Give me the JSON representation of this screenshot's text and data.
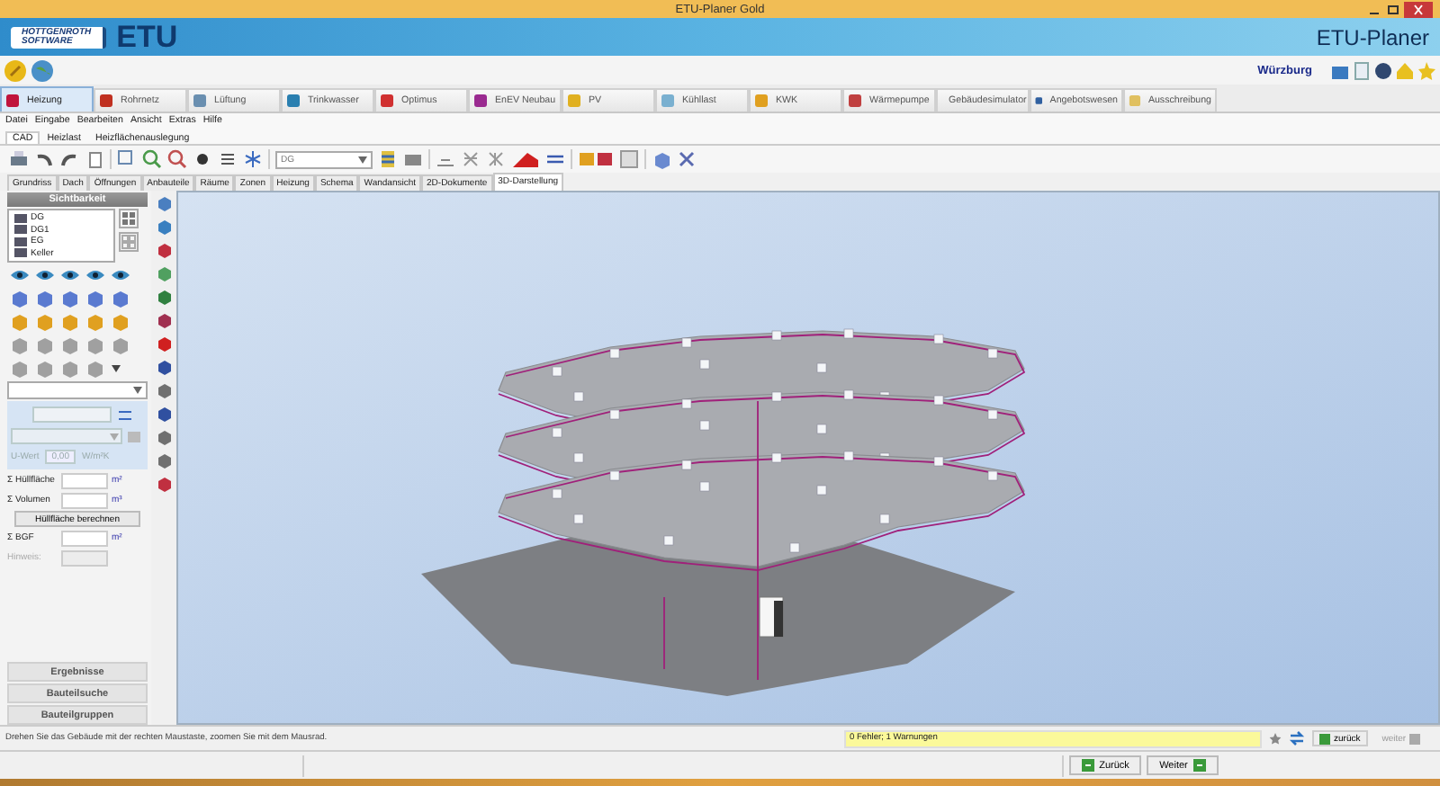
{
  "window": {
    "title": "ETU-Planer Gold"
  },
  "banner": {
    "company_line_1": "HOTTGENROTH",
    "company_line_2": "SOFTWARE",
    "logo": "ETU",
    "product": "ETU-Planer"
  },
  "location": "Würzburg",
  "module_tabs": [
    {
      "label": "Heizung",
      "selected": true
    },
    {
      "label": "Rohrnetz",
      "selected": false
    },
    {
      "label": "Lüftung",
      "selected": false
    },
    {
      "label": "Trinkwasser",
      "selected": false
    },
    {
      "label": "Optimus",
      "selected": false
    },
    {
      "label": "EnEV Neubau",
      "selected": false
    },
    {
      "label": "PV",
      "selected": false
    },
    {
      "label": "Kühllast",
      "selected": false
    },
    {
      "label": "KWK",
      "selected": false
    },
    {
      "label": "Wärmepumpe",
      "selected": false
    },
    {
      "label": "Gebäudesimulator",
      "selected": false
    },
    {
      "label": "Angebotswesen",
      "selected": false
    },
    {
      "label": "Ausschreibung",
      "selected": false
    }
  ],
  "menu": [
    "Datei",
    "Eingabe",
    "Bearbeiten",
    "Ansicht",
    "Extras",
    "Hilfe"
  ],
  "sub_tabs": [
    {
      "label": "CAD",
      "selected": true
    },
    {
      "label": "Heizlast",
      "selected": false
    },
    {
      "label": "Heizflächenauslegung",
      "selected": false
    }
  ],
  "toolbar": {
    "floor_select": "DG"
  },
  "view_tabs": [
    {
      "label": "Grundriss",
      "selected": false
    },
    {
      "label": "Dach",
      "selected": false
    },
    {
      "label": "Öffnungen",
      "selected": false
    },
    {
      "label": "Anbauteile",
      "selected": false
    },
    {
      "label": "Räume",
      "selected": false
    },
    {
      "label": "Zonen",
      "selected": false
    },
    {
      "label": "Heizung",
      "selected": false
    },
    {
      "label": "Schema",
      "selected": false
    },
    {
      "label": "Wandansicht",
      "selected": false
    },
    {
      "label": "2D-Dokumente",
      "selected": false
    },
    {
      "label": "3D-Darstellung",
      "selected": true
    }
  ],
  "visibility_panel": {
    "title": "Sichtbarkeit",
    "floors": [
      "DG",
      "DG1",
      "EG",
      "Keller"
    ]
  },
  "properties": {
    "u_value_label": "U-Wert",
    "u_value": "0,00",
    "u_value_unit": "W/m²K",
    "u_value_disabled": true,
    "fields": [
      {
        "label": "Σ Hüllfläche",
        "unit": "m²"
      },
      {
        "label": "Σ Volumen",
        "unit": "m³"
      }
    ],
    "calc_button": "Hüllfläche berechnen",
    "bgf_label": "Σ BGF",
    "bgf_unit": "m²",
    "note_label": "Hinweis:",
    "note_disabled": true
  },
  "accordion": [
    "Ergebnisse",
    "Bauteilsuche",
    "Bauteilgruppen"
  ],
  "status": {
    "hint": "Drehen Sie das Gebäude mit der rechten Maustaste, zoomen Sie mit dem Mausrad.",
    "messages": "0 Fehler; 1 Warnungen",
    "back_small": "zurück",
    "next_small": "weiter",
    "next_small_disabled": true
  },
  "footer": {
    "back": "Zurück",
    "next": "Weiter"
  }
}
